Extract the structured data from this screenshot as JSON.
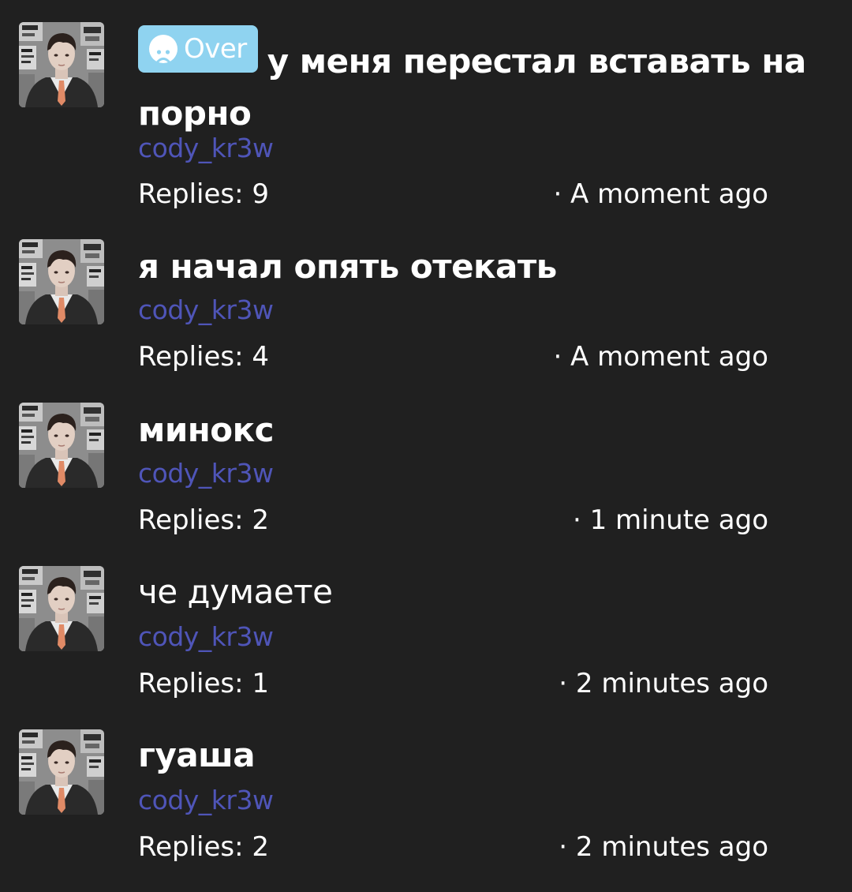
{
  "threads": [
    {
      "badge": {
        "label": "Over",
        "icon": "sad-face-icon",
        "color": "#8fd3f0"
      },
      "title": "у меня перестал вставать на порно",
      "author": "cody_kr3w",
      "replies": "Replies: 9",
      "time": "· A moment ago",
      "bold": true
    },
    {
      "title": "я начал опять отекать",
      "author": "cody_kr3w",
      "replies": "Replies: 4",
      "time": "· A moment ago",
      "bold": true
    },
    {
      "title": "минокс",
      "author": "cody_kr3w",
      "replies": "Replies: 2",
      "time": "· 1 minute ago",
      "bold": true
    },
    {
      "title": "че думаете",
      "author": "cody_kr3w",
      "replies": "Replies: 1",
      "time": "· 2 minutes ago",
      "bold": false
    },
    {
      "title": "гуаша",
      "author": "cody_kr3w",
      "replies": "Replies: 2",
      "time": "· 2 minutes ago",
      "bold": true
    }
  ],
  "colors": {
    "background": "#202020",
    "author": "#4f55b8",
    "text": "#ffffff"
  }
}
